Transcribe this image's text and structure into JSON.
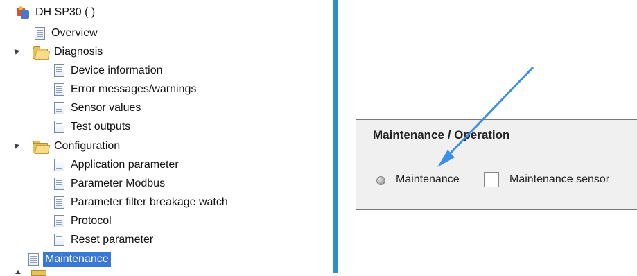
{
  "tree": {
    "root": {
      "label": "DH SP30 ( )",
      "icon": "device-icon"
    },
    "items": [
      {
        "label": "Overview",
        "icon": "document-icon"
      },
      {
        "label": "Diagnosis",
        "icon": "folder-icon",
        "expanded": true,
        "children": [
          {
            "label": "Device information"
          },
          {
            "label": "Error messages/warnings"
          },
          {
            "label": "Sensor values"
          },
          {
            "label": "Test outputs"
          }
        ]
      },
      {
        "label": "Configuration",
        "icon": "folder-icon",
        "expanded": true,
        "children": [
          {
            "label": "Application parameter"
          },
          {
            "label": "Parameter Modbus"
          },
          {
            "label": "Parameter filter breakage watch"
          },
          {
            "label": "Protocol"
          },
          {
            "label": "Reset parameter"
          }
        ]
      },
      {
        "label": "Maintenance",
        "icon": "document-icon",
        "selected": true
      }
    ]
  },
  "panel": {
    "title": "Maintenance / Operation",
    "indicator_label": "Maintenance",
    "indicator_state": "off",
    "checkbox_label": "Maintenance sensor",
    "checkbox_checked": false
  },
  "colors": {
    "splitter": "#2f8fc4",
    "selection": "#3a78d6",
    "arrow": "#3b8fe6",
    "panel_bg": "#f0f0f0"
  }
}
